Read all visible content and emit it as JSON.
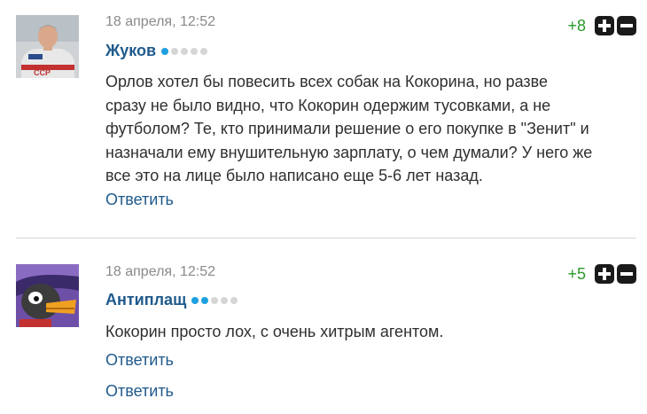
{
  "comments": [
    {
      "date": "18 апреля, 12:52",
      "author": "Жуков",
      "rating_level": 1,
      "rating_max": 5,
      "score": "+8",
      "lines": [
        "Орлов хотел бы повесить всех собак на Кокорина, но разве",
        "сразу не было видно, что Кокорин одержим тусовками, а не",
        "футболом? Те, кто принимали решение о его покупке в \"Зенит\" и",
        "назначали ему внушительную зарплату, о чем думали? У него же",
        "все это на лице было написано еще 5-6 лет назад."
      ],
      "reply_label": "Ответить",
      "avatar_icon": "hockey-player-avatar-icon"
    },
    {
      "date": "18 апреля, 12:52",
      "author": "Антиплащ",
      "rating_level": 2,
      "rating_max": 5,
      "score": "+5",
      "lines": [
        "Кокорин просто лох, с очень хитрым агентом."
      ],
      "reply_label": "Ответить",
      "reply_label_2": "Ответить",
      "avatar_icon": "cartoon-duck-avatar-icon"
    }
  ],
  "colors": {
    "author": "#1f5a8c",
    "score": "#2a9a2a",
    "dot_on": "#1e9fe0",
    "dot_off": "#d6d6d6",
    "date": "#8a8a8a"
  }
}
